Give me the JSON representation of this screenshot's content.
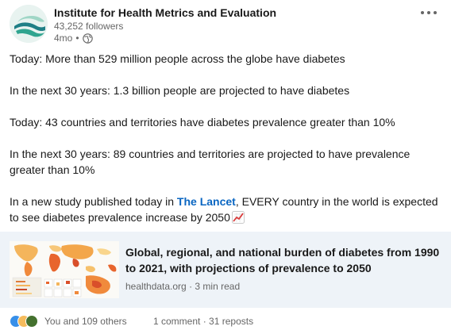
{
  "author": {
    "name": "Institute for Health Metrics and Evaluation",
    "followers": "43,252 followers",
    "time": "4mo",
    "separator": "•"
  },
  "post": {
    "p1": "Today: More than 529 million people across the globe have diabetes",
    "p2": "In the next 30 years: 1.3 billion people are projected to have diabetes",
    "p3": "Today: 43 countries and territories have diabetes prevalence greater than 10%",
    "p4": "In the next 30 years: 89 countries and territories are projected to have prevalence greater than 10%",
    "p5_before": "In a new study published today in ",
    "p5_link": "The Lancet",
    "p5_after": ", EVERY country in the world is expected to see diabetes prevalence increase by 2050"
  },
  "article": {
    "title": "Global, regional, and national burden of diabetes from 1990 to 2021, with projections of prevalence to 2050",
    "source": "healthdata.org",
    "sep": "·",
    "read_time": "3 min read"
  },
  "social": {
    "likes": "You and 109 others",
    "comments": "1 comment",
    "sep": "·",
    "reposts": "31 reposts"
  },
  "icons": {
    "more": "more-horizontal-icon",
    "visibility": "globe-icon",
    "emoji": "chart-increasing-icon"
  },
  "colors": {
    "link": "#0a66c2",
    "article_bg": "#eef3f8",
    "logo": "#2a8f8b"
  }
}
